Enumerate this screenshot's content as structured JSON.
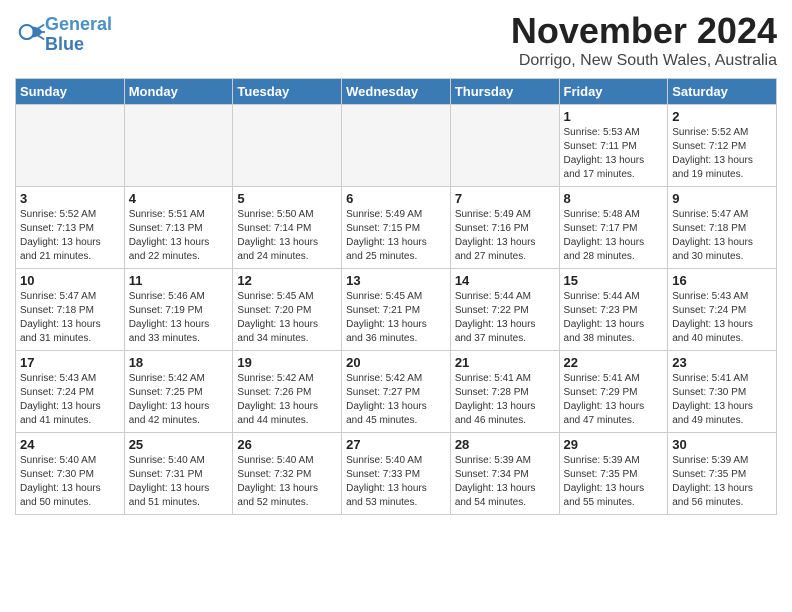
{
  "header": {
    "logo_line1": "General",
    "logo_line2": "Blue",
    "month_title": "November 2024",
    "location": "Dorrigo, New South Wales, Australia"
  },
  "days_of_week": [
    "Sunday",
    "Monday",
    "Tuesday",
    "Wednesday",
    "Thursday",
    "Friday",
    "Saturday"
  ],
  "weeks": [
    [
      {
        "day": "",
        "detail": ""
      },
      {
        "day": "",
        "detail": ""
      },
      {
        "day": "",
        "detail": ""
      },
      {
        "day": "",
        "detail": ""
      },
      {
        "day": "",
        "detail": ""
      },
      {
        "day": "1",
        "detail": "Sunrise: 5:53 AM\nSunset: 7:11 PM\nDaylight: 13 hours\nand 17 minutes."
      },
      {
        "day": "2",
        "detail": "Sunrise: 5:52 AM\nSunset: 7:12 PM\nDaylight: 13 hours\nand 19 minutes."
      }
    ],
    [
      {
        "day": "3",
        "detail": "Sunrise: 5:52 AM\nSunset: 7:13 PM\nDaylight: 13 hours\nand 21 minutes."
      },
      {
        "day": "4",
        "detail": "Sunrise: 5:51 AM\nSunset: 7:13 PM\nDaylight: 13 hours\nand 22 minutes."
      },
      {
        "day": "5",
        "detail": "Sunrise: 5:50 AM\nSunset: 7:14 PM\nDaylight: 13 hours\nand 24 minutes."
      },
      {
        "day": "6",
        "detail": "Sunrise: 5:49 AM\nSunset: 7:15 PM\nDaylight: 13 hours\nand 25 minutes."
      },
      {
        "day": "7",
        "detail": "Sunrise: 5:49 AM\nSunset: 7:16 PM\nDaylight: 13 hours\nand 27 minutes."
      },
      {
        "day": "8",
        "detail": "Sunrise: 5:48 AM\nSunset: 7:17 PM\nDaylight: 13 hours\nand 28 minutes."
      },
      {
        "day": "9",
        "detail": "Sunrise: 5:47 AM\nSunset: 7:18 PM\nDaylight: 13 hours\nand 30 minutes."
      }
    ],
    [
      {
        "day": "10",
        "detail": "Sunrise: 5:47 AM\nSunset: 7:18 PM\nDaylight: 13 hours\nand 31 minutes."
      },
      {
        "day": "11",
        "detail": "Sunrise: 5:46 AM\nSunset: 7:19 PM\nDaylight: 13 hours\nand 33 minutes."
      },
      {
        "day": "12",
        "detail": "Sunrise: 5:45 AM\nSunset: 7:20 PM\nDaylight: 13 hours\nand 34 minutes."
      },
      {
        "day": "13",
        "detail": "Sunrise: 5:45 AM\nSunset: 7:21 PM\nDaylight: 13 hours\nand 36 minutes."
      },
      {
        "day": "14",
        "detail": "Sunrise: 5:44 AM\nSunset: 7:22 PM\nDaylight: 13 hours\nand 37 minutes."
      },
      {
        "day": "15",
        "detail": "Sunrise: 5:44 AM\nSunset: 7:23 PM\nDaylight: 13 hours\nand 38 minutes."
      },
      {
        "day": "16",
        "detail": "Sunrise: 5:43 AM\nSunset: 7:24 PM\nDaylight: 13 hours\nand 40 minutes."
      }
    ],
    [
      {
        "day": "17",
        "detail": "Sunrise: 5:43 AM\nSunset: 7:24 PM\nDaylight: 13 hours\nand 41 minutes."
      },
      {
        "day": "18",
        "detail": "Sunrise: 5:42 AM\nSunset: 7:25 PM\nDaylight: 13 hours\nand 42 minutes."
      },
      {
        "day": "19",
        "detail": "Sunrise: 5:42 AM\nSunset: 7:26 PM\nDaylight: 13 hours\nand 44 minutes."
      },
      {
        "day": "20",
        "detail": "Sunrise: 5:42 AM\nSunset: 7:27 PM\nDaylight: 13 hours\nand 45 minutes."
      },
      {
        "day": "21",
        "detail": "Sunrise: 5:41 AM\nSunset: 7:28 PM\nDaylight: 13 hours\nand 46 minutes."
      },
      {
        "day": "22",
        "detail": "Sunrise: 5:41 AM\nSunset: 7:29 PM\nDaylight: 13 hours\nand 47 minutes."
      },
      {
        "day": "23",
        "detail": "Sunrise: 5:41 AM\nSunset: 7:30 PM\nDaylight: 13 hours\nand 49 minutes."
      }
    ],
    [
      {
        "day": "24",
        "detail": "Sunrise: 5:40 AM\nSunset: 7:30 PM\nDaylight: 13 hours\nand 50 minutes."
      },
      {
        "day": "25",
        "detail": "Sunrise: 5:40 AM\nSunset: 7:31 PM\nDaylight: 13 hours\nand 51 minutes."
      },
      {
        "day": "26",
        "detail": "Sunrise: 5:40 AM\nSunset: 7:32 PM\nDaylight: 13 hours\nand 52 minutes."
      },
      {
        "day": "27",
        "detail": "Sunrise: 5:40 AM\nSunset: 7:33 PM\nDaylight: 13 hours\nand 53 minutes."
      },
      {
        "day": "28",
        "detail": "Sunrise: 5:39 AM\nSunset: 7:34 PM\nDaylight: 13 hours\nand 54 minutes."
      },
      {
        "day": "29",
        "detail": "Sunrise: 5:39 AM\nSunset: 7:35 PM\nDaylight: 13 hours\nand 55 minutes."
      },
      {
        "day": "30",
        "detail": "Sunrise: 5:39 AM\nSunset: 7:35 PM\nDaylight: 13 hours\nand 56 minutes."
      }
    ]
  ]
}
